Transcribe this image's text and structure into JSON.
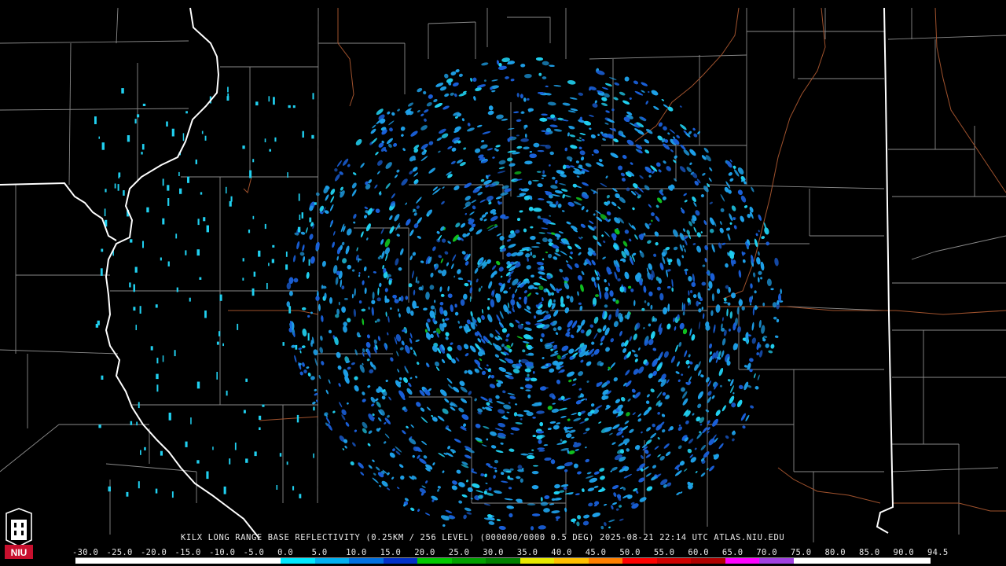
{
  "caption": "KILX LONG RANGE BASE REFLECTIVITY (0.25KM / 256 LEVEL) (000000/0000 0.5 DEG) 2025-08-21 22:14 UTC  ATLAS.NIU.EDU",
  "logo_text": "NIU",
  "colorbar": {
    "labels": [
      "-30.0",
      "-25.0",
      "-20.0",
      "-15.0",
      "-10.0",
      "-5.0",
      "0.0",
      "5.0",
      "10.0",
      "15.0",
      "20.0",
      "25.0",
      "30.0",
      "35.0",
      "40.0",
      "45.0",
      "50.0",
      "55.0",
      "60.0",
      "65.0",
      "70.0",
      "75.0",
      "80.0",
      "85.0",
      "90.0",
      "94.5"
    ],
    "colors": [
      "#ffffff",
      "#ffffff",
      "#ffffff",
      "#ffffff",
      "#ffffff",
      "#ffffff",
      "#00e8ff",
      "#00b0f0",
      "#0070e0",
      "#0030c8",
      "#00c800",
      "#00a000",
      "#008000",
      "#e8e800",
      "#ffc000",
      "#ff8000",
      "#ff0000",
      "#d00000",
      "#b00000",
      "#ff00ff",
      "#a040e0",
      "#ffffff",
      "#ffffff",
      "#ffffff",
      "#ffffff"
    ]
  },
  "colors": {
    "background": "#000000",
    "county_lines": "#8a8a8a",
    "state_lines": "#ffffff",
    "highways": "#a0522d",
    "echo_light": "#1ea0e8",
    "echo_medium": "#1a5fd8",
    "echo_cyan": "#20d0f0",
    "echo_green": "#10c020"
  }
}
